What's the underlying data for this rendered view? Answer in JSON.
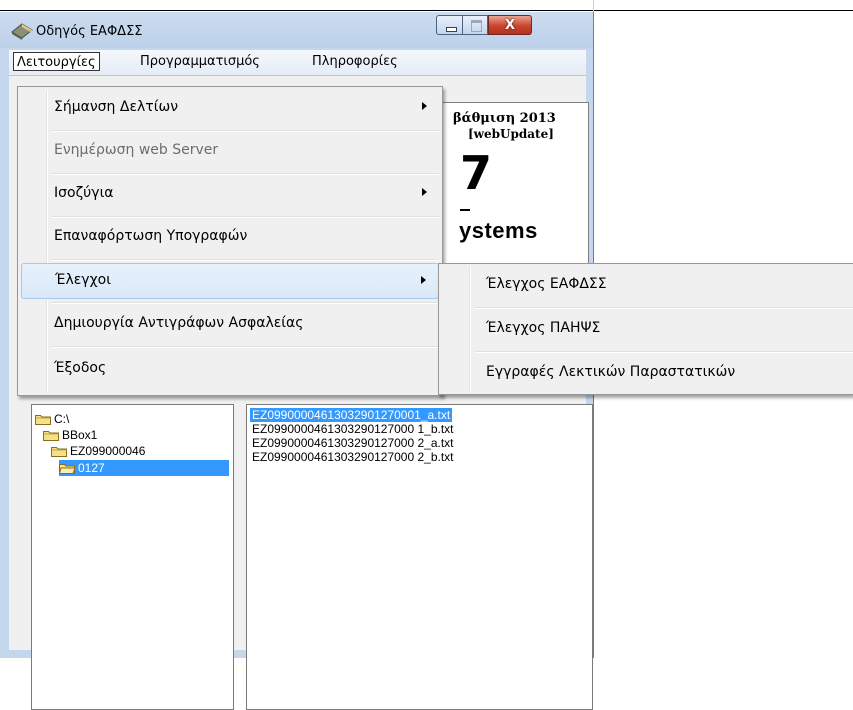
{
  "window": {
    "title": "Οδηγός ΕΑΦΔΣΣ",
    "close_glyph": "X"
  },
  "menubar": {
    "items": [
      {
        "label": "Λειτουργίες",
        "active": true
      },
      {
        "label": "Προγραμματισμός"
      },
      {
        "label": "Πληροφορίες"
      }
    ]
  },
  "dropdown": {
    "items": [
      {
        "label": "Σήμανση Δελτίων",
        "has_submenu": true
      },
      {
        "label": "Ενημέρωση web Server",
        "disabled": true
      },
      {
        "label": "Ισοζύγια",
        "has_submenu": true
      },
      {
        "label": "Επαναφόρτωση Υπογραφών"
      },
      {
        "label": "Έλεγχοι",
        "has_submenu": true,
        "highlighted": true
      },
      {
        "label": "Δημιουργία Αντιγράφων Ασφαλείας"
      },
      {
        "label": "Έξοδος"
      }
    ]
  },
  "submenu": {
    "items": [
      {
        "label": "Έλεγχος ΕΑΦΔΣΣ"
      },
      {
        "label": "Έλεγχος ΠΑΗΨΣ"
      },
      {
        "label": "Εγγραφές Λεκτικών Παραστατικών"
      }
    ]
  },
  "banner": {
    "line1": "βάθμιση 2013",
    "line2": "[webUpdate]",
    "big": "7",
    "brand": "ystems"
  },
  "tree": {
    "nodes": [
      {
        "label": "C:\\",
        "depth": 0
      },
      {
        "label": "BBox1",
        "depth": 1
      },
      {
        "label": "EZ099000046",
        "depth": 2
      },
      {
        "label": "0127",
        "depth": 3,
        "selected": true
      }
    ]
  },
  "files": [
    {
      "name": "EZ09900004613032901270001_a.txt",
      "selected": true
    },
    {
      "name": "EZ0990000461303290127000 1_b.txt"
    },
    {
      "name": "EZ0990000461303290127000 2_a.txt"
    },
    {
      "name": "EZ0990000461303290127000 2_b.txt"
    }
  ],
  "colors": {
    "selection": "#3399ff",
    "menu_background": "#f0f0f0",
    "window_frame": "#c4d7ed",
    "close_button": "#c9442c"
  },
  "icons": {
    "app": "app-icon",
    "folder": "folder-icon",
    "submenu_arrow": "submenu-arrow-icon"
  }
}
